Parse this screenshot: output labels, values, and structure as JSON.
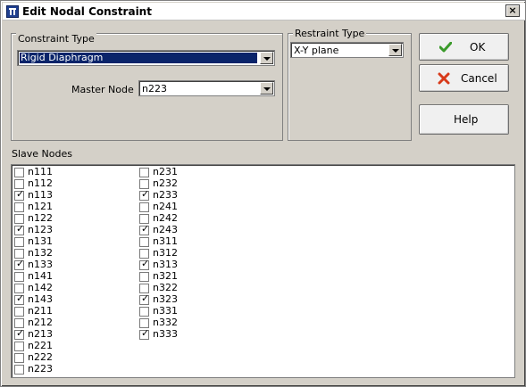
{
  "window": {
    "title": "Edit Nodal Constraint",
    "close_glyph": "×"
  },
  "constraint_type": {
    "group_label": "Constraint Type",
    "selected": "Rigid Diaphragm",
    "master_node_label": "Master Node",
    "master_node_value": "n223"
  },
  "restraint_type": {
    "group_label": "Restraint Type",
    "selected": "X-Y plane"
  },
  "buttons": {
    "ok": "OK",
    "cancel": "Cancel",
    "help": "Help"
  },
  "slave_nodes": {
    "label": "Slave Nodes",
    "column1": [
      {
        "name": "n111",
        "checked": false
      },
      {
        "name": "n112",
        "checked": false
      },
      {
        "name": "n113",
        "checked": true
      },
      {
        "name": "n121",
        "checked": false
      },
      {
        "name": "n122",
        "checked": false
      },
      {
        "name": "n123",
        "checked": true
      },
      {
        "name": "n131",
        "checked": false
      },
      {
        "name": "n132",
        "checked": false
      },
      {
        "name": "n133",
        "checked": true
      },
      {
        "name": "n141",
        "checked": false
      },
      {
        "name": "n142",
        "checked": false
      },
      {
        "name": "n143",
        "checked": true
      },
      {
        "name": "n211",
        "checked": false
      },
      {
        "name": "n212",
        "checked": false
      },
      {
        "name": "n213",
        "checked": true
      },
      {
        "name": "n221",
        "checked": false
      },
      {
        "name": "n222",
        "checked": false
      },
      {
        "name": "n223",
        "checked": false
      }
    ],
    "column2": [
      {
        "name": "n231",
        "checked": false
      },
      {
        "name": "n232",
        "checked": false
      },
      {
        "name": "n233",
        "checked": true
      },
      {
        "name": "n241",
        "checked": false
      },
      {
        "name": "n242",
        "checked": false
      },
      {
        "name": "n243",
        "checked": true
      },
      {
        "name": "n311",
        "checked": false
      },
      {
        "name": "n312",
        "checked": false
      },
      {
        "name": "n313",
        "checked": true
      },
      {
        "name": "n321",
        "checked": false
      },
      {
        "name": "n322",
        "checked": false
      },
      {
        "name": "n323",
        "checked": true
      },
      {
        "name": "n331",
        "checked": false
      },
      {
        "name": "n332",
        "checked": false
      },
      {
        "name": "n333",
        "checked": true
      }
    ]
  },
  "colors": {
    "dialog_bg": "#d4d0c8",
    "selection_bg": "#0a246a",
    "ok_check": "#3a9a2a",
    "cancel_x": "#d83a1a"
  }
}
